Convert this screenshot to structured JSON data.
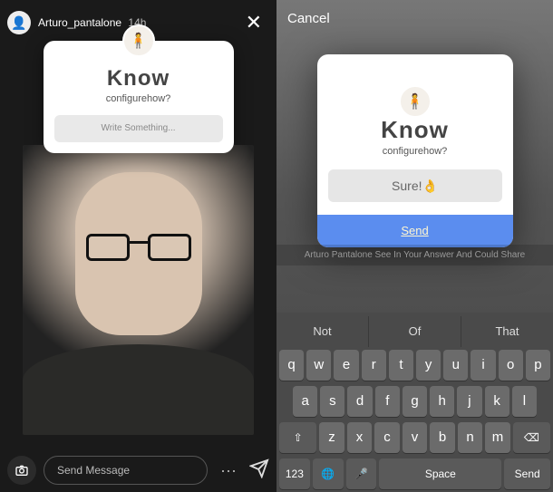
{
  "left": {
    "username": "Arturo_pantalone",
    "time": "14h",
    "close": "✕",
    "card": {
      "title": "Know",
      "subtitle": "configurehow?",
      "placeholder": "Write Something..."
    },
    "footer": {
      "camera_icon": "camera-icon",
      "message_placeholder": "Send Message",
      "more": "···",
      "send_icon": "paper-plane-icon"
    }
  },
  "right": {
    "cancel": "Cancel",
    "card": {
      "title": "Know",
      "subtitle": "configurehow?",
      "answer": "Sure!👌",
      "send": "Send"
    },
    "disclaimer": "Arturo Pantalone See In Your Answer And Could Share",
    "suggestions": [
      "Not",
      "Of",
      "That"
    ],
    "keys_row1": [
      "q",
      "w",
      "e",
      "r",
      "t",
      "y",
      "u",
      "i",
      "o",
      "p"
    ],
    "keys_row2": [
      "a",
      "s",
      "d",
      "f",
      "g",
      "h",
      "j",
      "k",
      "l"
    ],
    "keys_row3_shift": "⇧",
    "keys_row3": [
      "z",
      "x",
      "c",
      "v",
      "b",
      "n",
      "m"
    ],
    "keys_row3_bksp": "⌫",
    "keys_row4": {
      "num": "123",
      "globe": "🌐",
      "mic": "🎤",
      "space": "Space",
      "send": "Send"
    }
  }
}
